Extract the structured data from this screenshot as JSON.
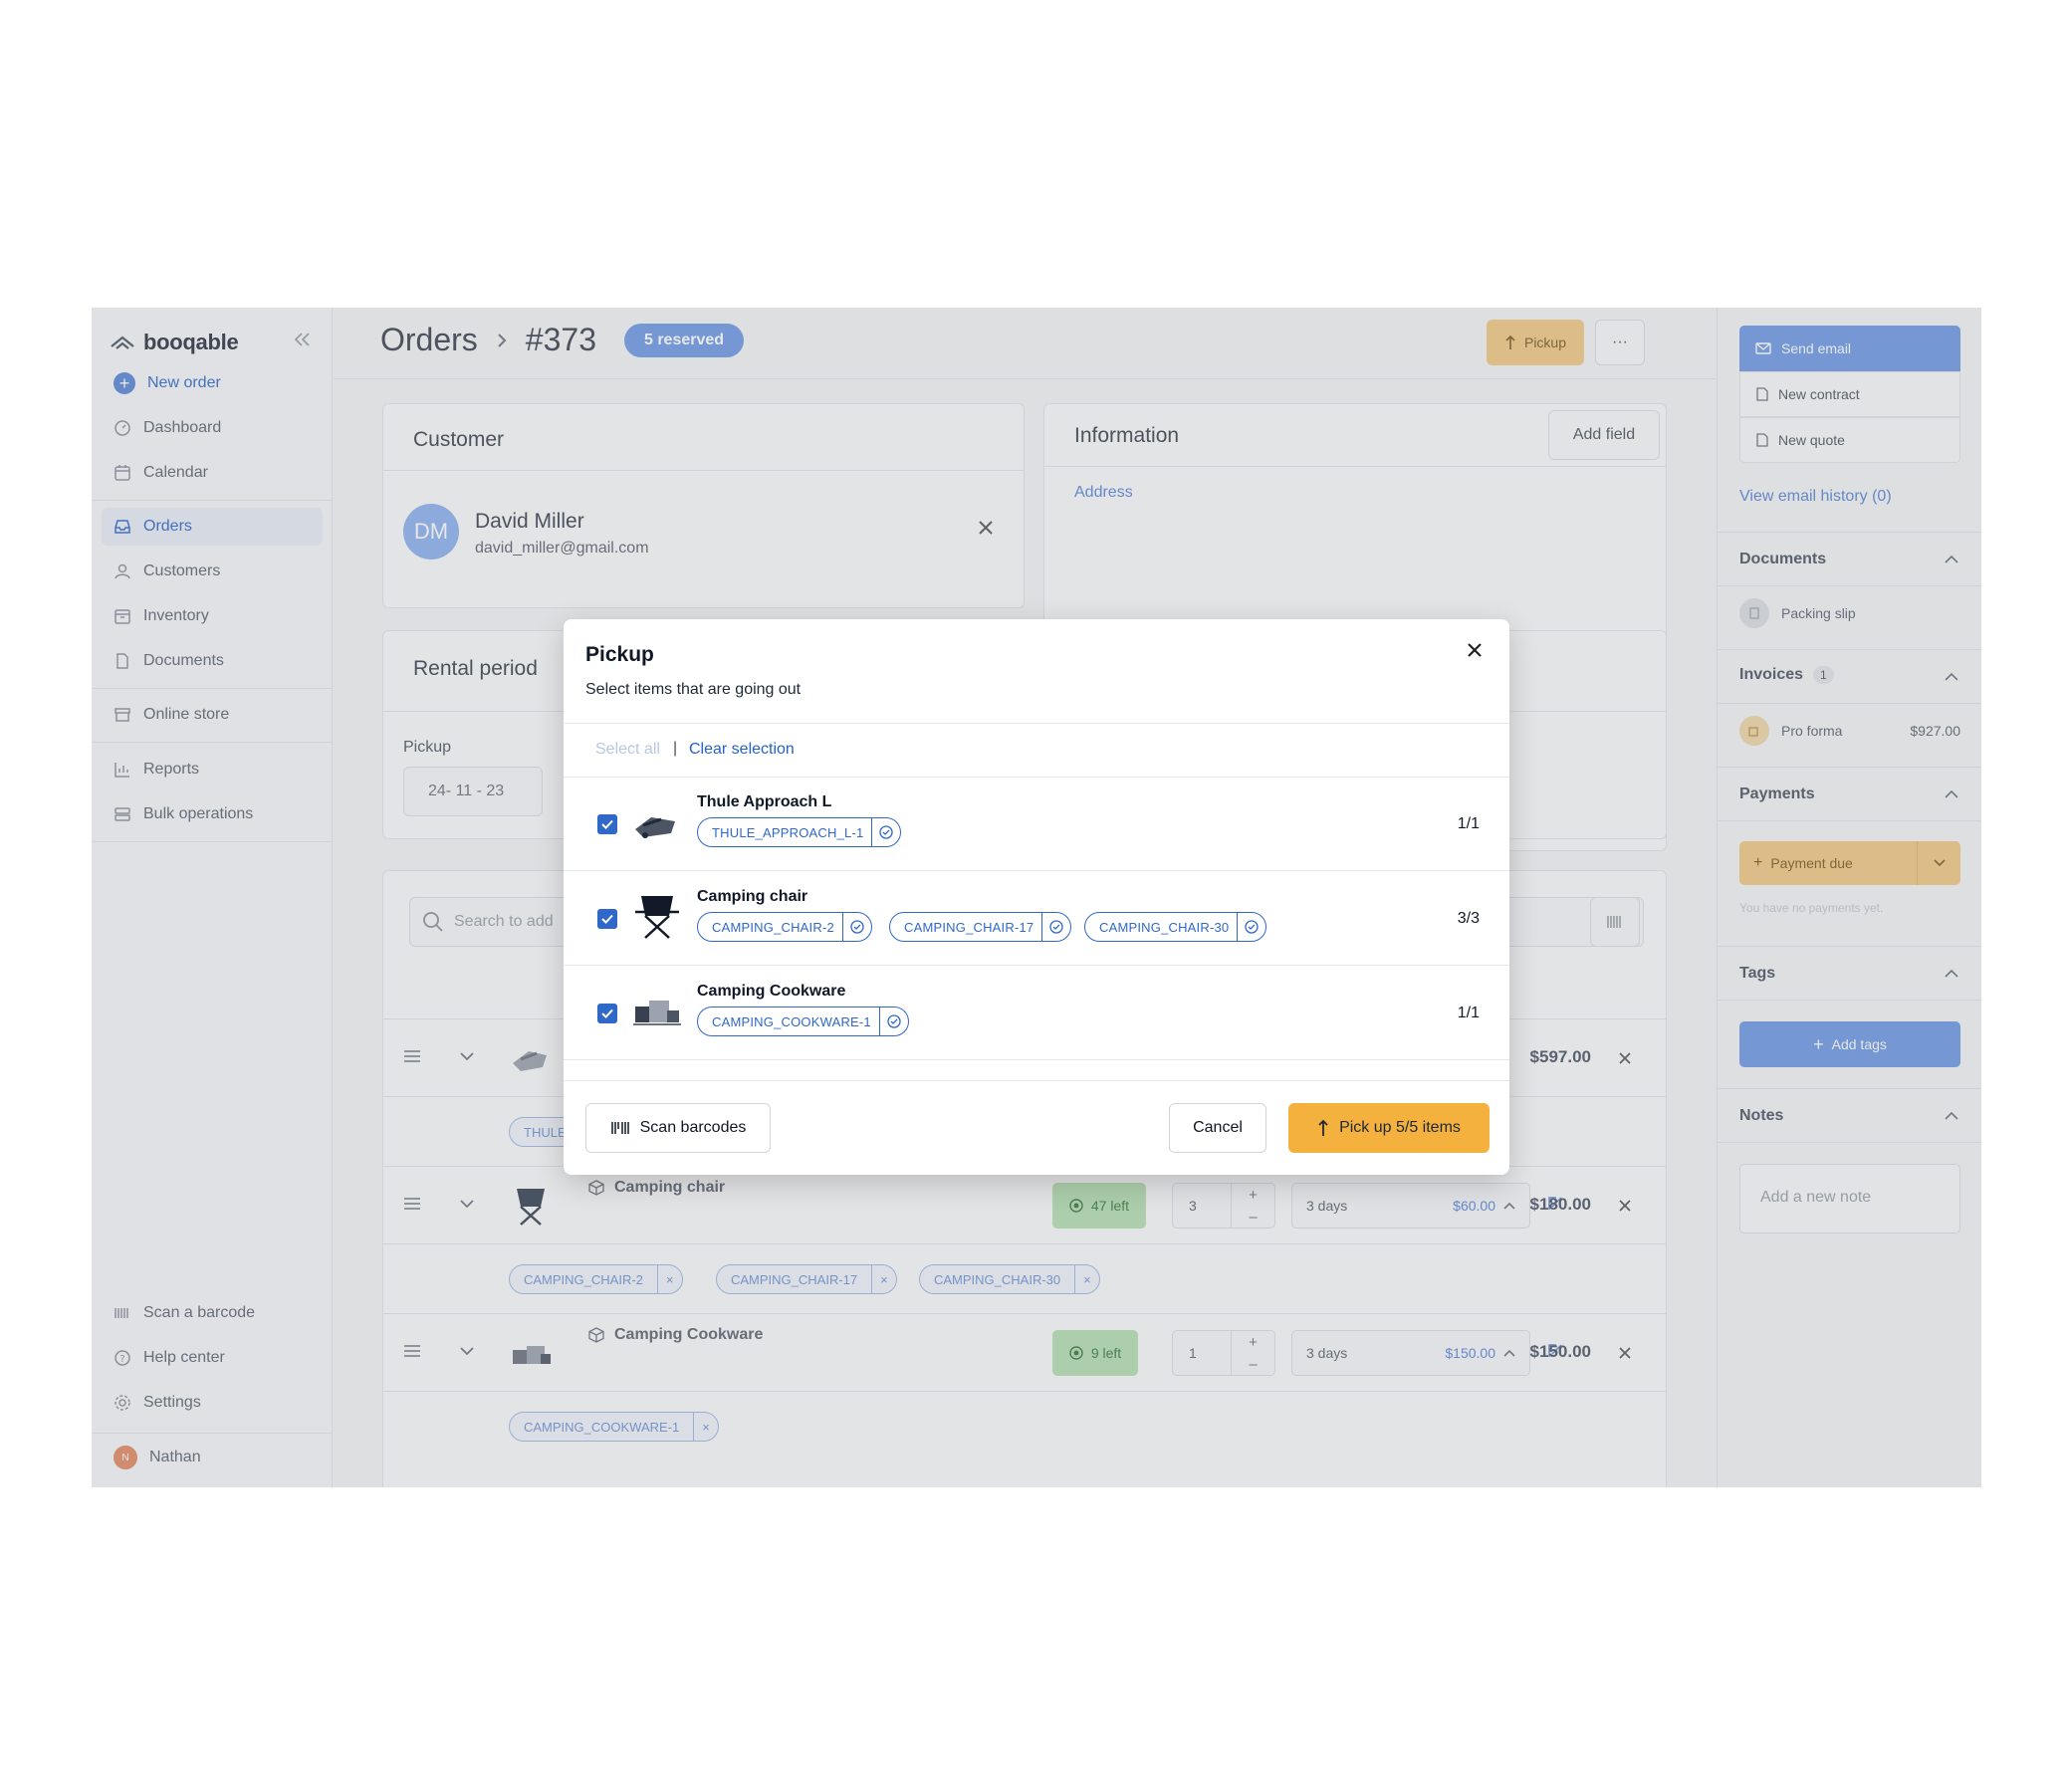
{
  "app": {
    "logo_text": "booqable"
  },
  "sidebar": {
    "new_order": "New order",
    "items": [
      {
        "label": "Dashboard",
        "icon": "dashboard-icon"
      },
      {
        "label": "Calendar",
        "icon": "calendar-icon"
      },
      {
        "label": "Orders",
        "icon": "inbox-icon"
      },
      {
        "label": "Customers",
        "icon": "user-icon"
      },
      {
        "label": "Inventory",
        "icon": "box-icon"
      },
      {
        "label": "Documents",
        "icon": "document-icon"
      },
      {
        "label": "Online store",
        "icon": "store-icon"
      },
      {
        "label": "Reports",
        "icon": "chart-icon"
      },
      {
        "label": "Bulk operations",
        "icon": "stack-icon"
      }
    ],
    "bottom": [
      {
        "label": "Scan a barcode",
        "icon": "barcode-icon"
      },
      {
        "label": "Help center",
        "icon": "help-icon"
      },
      {
        "label": "Settings",
        "icon": "gear-icon"
      }
    ],
    "user": {
      "name": "Nathan",
      "initial": "N"
    }
  },
  "header": {
    "section": "Orders",
    "order_number": "#373",
    "status_badge": "5 reserved",
    "pickup_button": "Pickup",
    "more": "···"
  },
  "customer": {
    "title": "Customer",
    "initials": "DM",
    "name": "David Miller",
    "email": "david_miller@gmail.com"
  },
  "information": {
    "title": "Information",
    "add_field": "Add field",
    "address_link": "Address"
  },
  "rental_period": {
    "title": "Rental period",
    "pickup_label": "Pickup",
    "pickup_date": "24- 11 - 23"
  },
  "lines": {
    "search_placeholder": "Search to add",
    "rows": [
      {
        "name": "Thule Approach L",
        "total": "$597.00",
        "chips": [
          "THULE"
        ]
      },
      {
        "name": "Camping chair",
        "availability": "47 left",
        "quantity": "3",
        "period": "3 days",
        "price": "$60.00",
        "total": "$180.00",
        "chips": [
          "CAMPING_CHAIR-2",
          "CAMPING_CHAIR-17",
          "CAMPING_CHAIR-30"
        ]
      },
      {
        "name": "Camping Cookware",
        "availability": "9 left",
        "quantity": "1",
        "period": "3 days",
        "price": "$150.00",
        "total": "$150.00",
        "chips": [
          "CAMPING_COOKWARE-1"
        ]
      }
    ]
  },
  "right_panel": {
    "send_email": "Send email",
    "new_contract": "New contract",
    "new_quote": "New quote",
    "email_history": "View email history (0)",
    "documents": {
      "title": "Documents",
      "item": "Packing slip"
    },
    "invoices": {
      "title": "Invoices",
      "count": "1",
      "item": "Pro forma",
      "amount": "$927.00"
    },
    "payments": {
      "title": "Payments",
      "button": "Payment due",
      "empty": "You have no payments yet."
    },
    "tags": {
      "title": "Tags",
      "button": "Add tags"
    },
    "notes": {
      "title": "Notes",
      "placeholder": "Add a new note"
    }
  },
  "modal": {
    "title": "Pickup",
    "subtitle": "Select items that are going out",
    "select_all": "Select all",
    "pipe": "|",
    "clear_selection": "Clear selection",
    "items": [
      {
        "name": "Thule Approach L",
        "count": "1/1",
        "checked": true,
        "chips": [
          "THULE_APPROACH_L-1"
        ]
      },
      {
        "name": "Camping chair",
        "count": "3/3",
        "checked": true,
        "chips": [
          "CAMPING_CHAIR-2",
          "CAMPING_CHAIR-17",
          "CAMPING_CHAIR-30"
        ]
      },
      {
        "name": "Camping Cookware",
        "count": "1/1",
        "checked": true,
        "chips": [
          "CAMPING_COOKWARE-1"
        ]
      }
    ],
    "scan_barcodes": "Scan barcodes",
    "cancel": "Cancel",
    "confirm": "Pick up 5/5 items"
  },
  "colors": {
    "accent_blue": "#2f68c9",
    "pickup_orange": "#f5b13d",
    "availability_green": "#b5dfb3"
  }
}
